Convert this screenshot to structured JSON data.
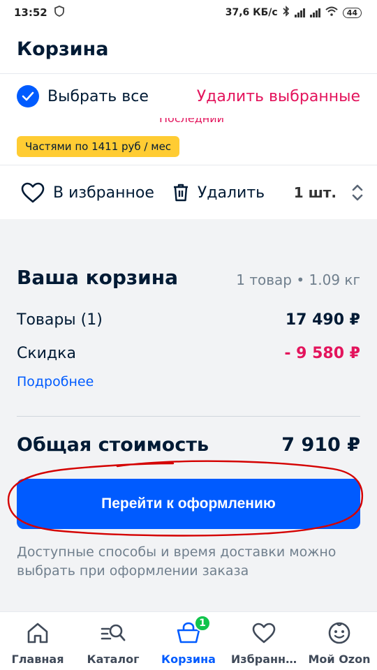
{
  "status_bar": {
    "time": "13:52",
    "net_speed": "37,6 КБ/с",
    "battery": "44"
  },
  "header": {
    "title": "Корзина"
  },
  "select_row": {
    "select_all_label": "Выбрать все",
    "delete_selected_label": "Удалить выбранные",
    "last_label": "Последний"
  },
  "installment": {
    "text": "Частями по 1411 руб / мес"
  },
  "actions": {
    "favorite_label": "В избранное",
    "delete_label": "Удалить",
    "qty_label": "1 шт."
  },
  "summary": {
    "title": "Ваша корзина",
    "meta": "1 товар • 1.09 кг",
    "goods_label": "Товары (1)",
    "goods_value": "17 490 ₽",
    "discount_label": "Скидка",
    "discount_value": "- 9 580 ₽",
    "more_link": "Подробнее",
    "total_label": "Общая стоимость",
    "total_value": "7 910 ₽",
    "checkout_label": "Перейти к оформлению",
    "delivery_note": "Доступные способы и время доставки можно выбрать при оформлении заказа"
  },
  "bottom_nav": {
    "items": [
      {
        "label": "Главная",
        "icon": "home-icon"
      },
      {
        "label": "Каталог",
        "icon": "catalog-search-icon"
      },
      {
        "label": "Корзина",
        "icon": "cart-icon",
        "badge": "1"
      },
      {
        "label": "Избранн…",
        "icon": "heart-icon"
      },
      {
        "label": "Мой Ozon",
        "icon": "smiley-icon"
      }
    ]
  },
  "colors": {
    "accent": "#005bff",
    "danger": "#e3145c",
    "installment_bg": "#ffcc33",
    "badge": "#10c44c",
    "annotation": "#d40000"
  }
}
